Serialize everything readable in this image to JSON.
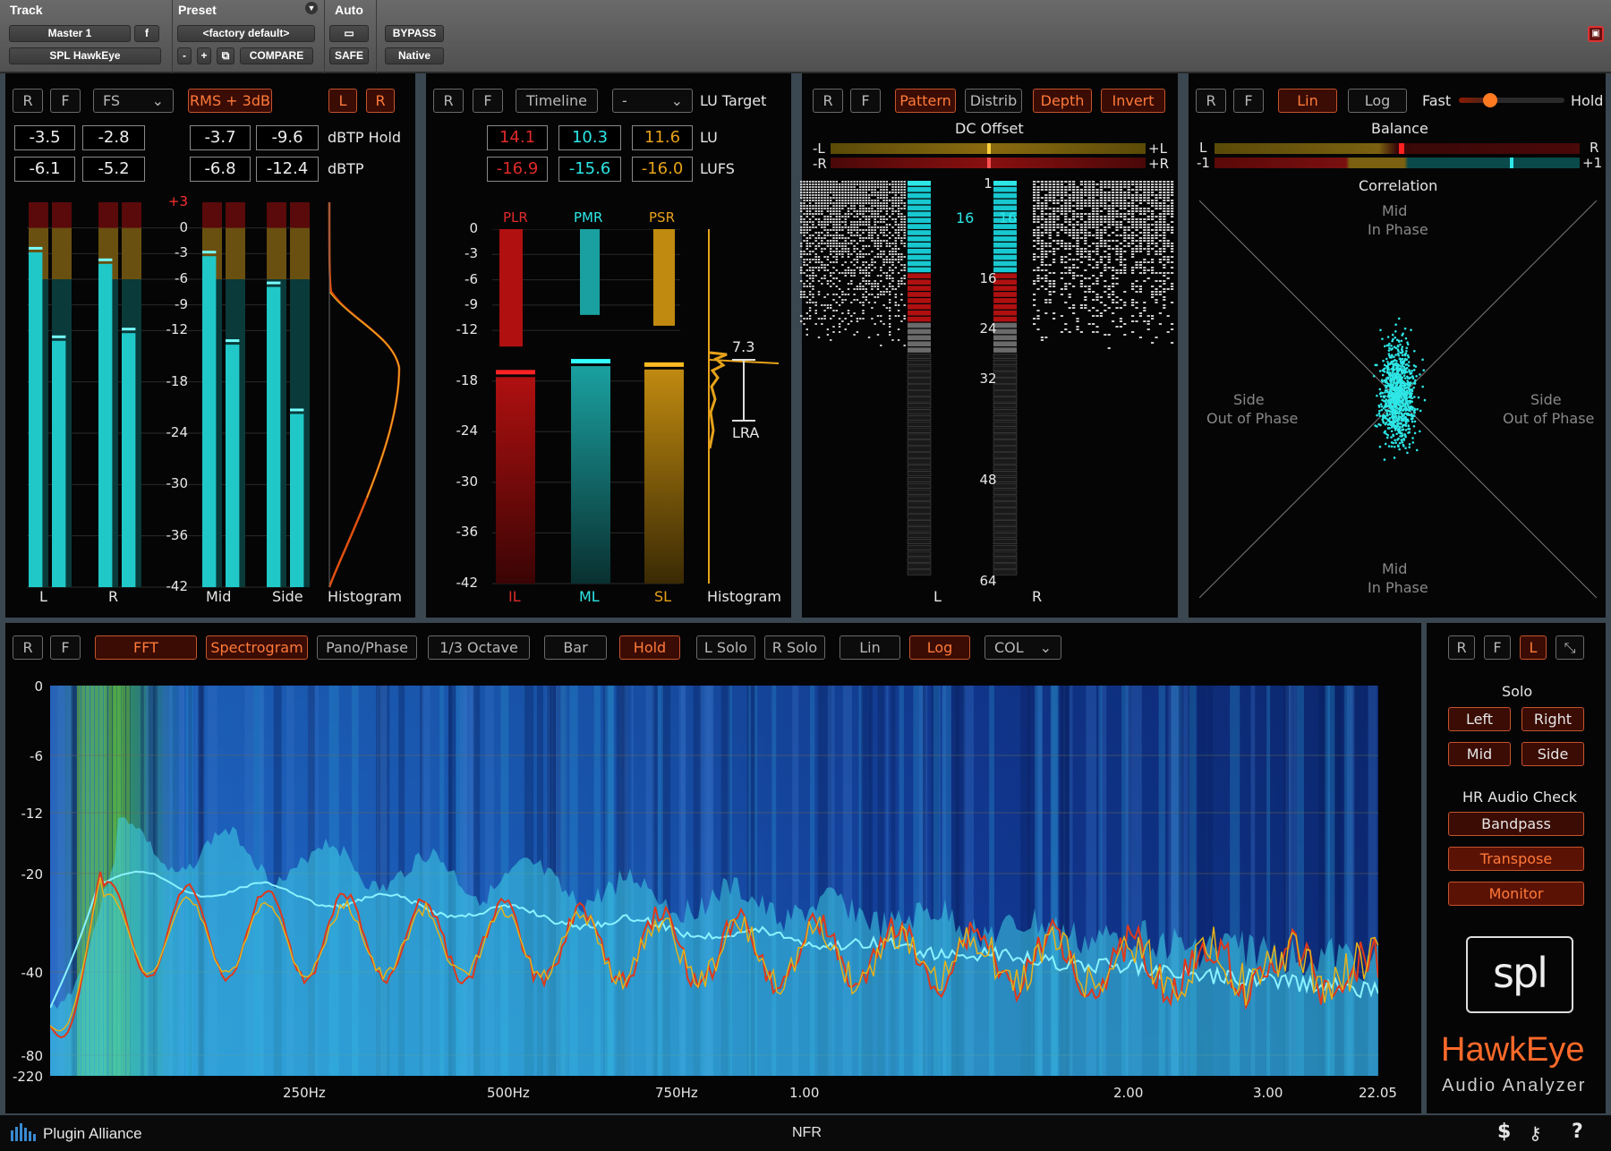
{
  "host": {
    "track_label": "Track",
    "preset_label": "Preset",
    "auto_label": "Auto",
    "track_name": "Master 1",
    "track_f": "f",
    "plugin_name": "SPL HawkEye",
    "preset_name": "<factory default>",
    "minus": "-",
    "plus": "+",
    "compare": "COMPARE",
    "safe": "SAFE",
    "bypass": "BYPASS",
    "native": "Native"
  },
  "level": {
    "r": "R",
    "f": "F",
    "fs": "FS",
    "rms": "RMS + 3dB",
    "l": "L",
    "rr": "R",
    "hold_row": [
      "-3.5",
      "-2.8",
      "-3.7",
      "-9.6"
    ],
    "dbtp_row": [
      "-6.1",
      "-5.2",
      "-6.8",
      "-12.4"
    ],
    "hold_label": "dBTP Hold",
    "dbtp_label": "dBTP",
    "scale": [
      "+3",
      "0",
      "-3",
      "-6",
      "-9",
      "-12",
      "-18",
      "-24",
      "-30",
      "-36",
      "-42"
    ],
    "bottom": [
      "L",
      "R",
      "Mid",
      "Side",
      "Histogram"
    ],
    "meter_levels": {
      "L": [
        0.87,
        0.64
      ],
      "R": [
        0.84,
        0.66
      ],
      "Mid": [
        0.86,
        0.63
      ],
      "Side": [
        0.78,
        0.45
      ]
    }
  },
  "loud": {
    "r": "R",
    "f": "F",
    "timeline": "Timeline",
    "target_value": "-",
    "target_label": "LU Target",
    "lu": [
      "14.1",
      "10.3",
      "11.6"
    ],
    "lufs": [
      "-16.9",
      "-15.6",
      "-16.0"
    ],
    "lu_label": "LU",
    "lufs_label": "LUFS",
    "tops": [
      "PLR",
      "PMR",
      "PSR"
    ],
    "scale": [
      "0",
      "-3",
      "-6",
      "-9",
      "-12",
      "-18",
      "-24",
      "-30",
      "-36",
      "-42"
    ],
    "bottom": [
      "IL",
      "ML",
      "SL",
      "Histogram"
    ],
    "lra_value": "7.3",
    "lra_label": "LRA",
    "bars": {
      "PLR": 14.1,
      "PMR": 10.3,
      "PSR": 11.6,
      "IL": -16.9,
      "ML": -15.6,
      "SL": -16.0
    }
  },
  "bits": {
    "r": "R",
    "f": "F",
    "pattern": "Pattern",
    "distrib": "Distrib",
    "depth": "Depth",
    "invert": "Invert",
    "dc_label": "DC Offset",
    "dc_l": "-L",
    "dc_r": "-R",
    "dc_pl": "+L",
    "dc_pr": "+R",
    "depth_l": "16",
    "depth_r": "16",
    "scale": [
      "1",
      "16",
      "24",
      "32",
      "48",
      "64"
    ],
    "bottom": [
      "L",
      "R"
    ]
  },
  "phase": {
    "r": "R",
    "f": "F",
    "lin": "Lin",
    "log": "Log",
    "fast": "Fast",
    "hold": "Hold",
    "balance": "Balance",
    "bal_l": "L",
    "bal_r": "R",
    "corr_m": "-1",
    "corr_p": "+1",
    "correlation": "Correlation",
    "mid_top": "Mid",
    "in_phase_top": "In Phase",
    "side_l": "Side",
    "oop_l": "Out of Phase",
    "side_r": "Side",
    "oop_r": "Out of Phase",
    "mid_bot": "Mid",
    "in_phase_bot": "In Phase",
    "speed": 0.3
  },
  "spectrum": {
    "r": "R",
    "f": "F",
    "fft": "FFT",
    "spectrogram": "Spectrogram",
    "pano": "Pano/Phase",
    "octave": "1/3 Octave",
    "bar": "Bar",
    "hold": "Hold",
    "lsolo": "L Solo",
    "rsolo": "R Solo",
    "lin": "Lin",
    "log": "Log",
    "col": "COL",
    "yticks": [
      "0",
      "-6",
      "-12",
      "-20",
      "-40",
      "-80",
      "-220"
    ],
    "xticks": [
      "250Hz",
      "500Hz",
      "750Hz",
      "1.00",
      "2.00",
      "3.00",
      "22.05"
    ]
  },
  "side": {
    "r": "R",
    "f": "F",
    "l": "L",
    "solo": "Solo",
    "left": "Left",
    "right": "Right",
    "mid": "Mid",
    "sidebtn": "Side",
    "hr": "HR Audio Check",
    "bandpass": "Bandpass",
    "transpose": "Transpose",
    "monitor": "Monitor",
    "logo": "spl",
    "product": "HawkEye",
    "sub": "Audio Analyzer"
  },
  "footer": {
    "brand": "Plugin Alliance",
    "mode": "NFR",
    "dollar": "$",
    "help": "?"
  },
  "colors": {
    "accent": "#ff7a3a",
    "cyan": "#2ee6e6",
    "red": "#c81414",
    "gold": "#e6a21a"
  }
}
